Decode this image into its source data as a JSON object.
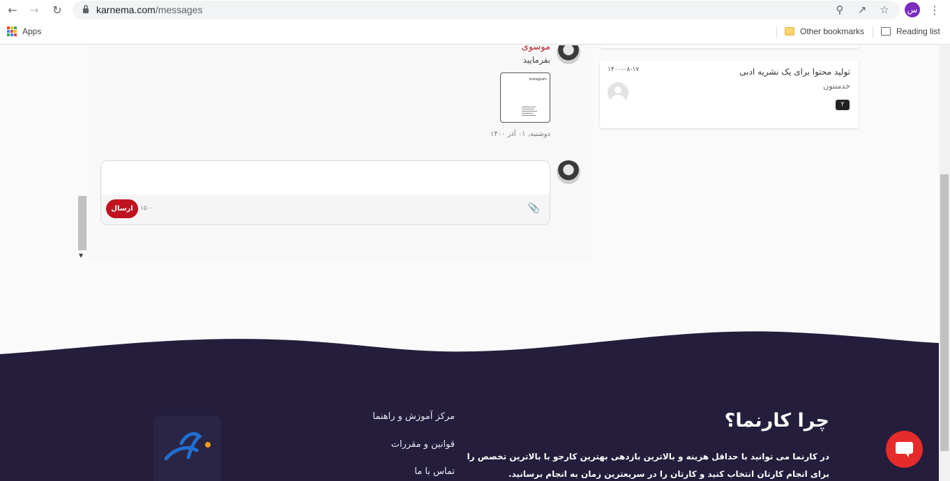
{
  "browser": {
    "url_domain": "karnema.com",
    "url_path": "/messages",
    "profile_initial": "س",
    "bookmarks": {
      "apps_label": "Apps",
      "other_label": "Other bookmarks",
      "reading_label": "Reading list"
    }
  },
  "chat": {
    "message": {
      "sender": "موسوی",
      "text": "بفرمایید",
      "date": "دوشنبه, ۰۱ آذر ۱۴۰۰",
      "attachment": "Instagram"
    },
    "composer": {
      "send_label": "ارسال",
      "char_count": "۱۵۰۰"
    }
  },
  "conversations": [
    {
      "title": "تولید محتوا برای یک نشریه ادبی",
      "subtitle": "خدمتتون",
      "date": "۱۴۰۰-۰۸-۱۷",
      "unread": "۲"
    }
  ],
  "footer": {
    "why_title": "چرا کارنما؟",
    "why_text": "در کارنما می توانید با حداقل هزینه و بالاترین بازدهی بهترین کارجو با بالاترین تخصص را برای انجام کارتان انتخاب کنید و کارتان را در سریعترین زمان به انجام برسانید.",
    "links": [
      "مرکز آموزش و راهنما",
      "قوانین و مقررات",
      "تماس با ما"
    ]
  },
  "colors": {
    "accent_red": "#c1121f",
    "footer_bg": "#241d3c",
    "profile": "#7b2cbf"
  }
}
